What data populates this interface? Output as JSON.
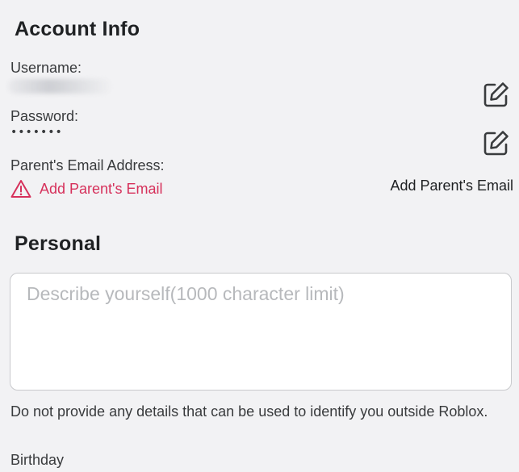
{
  "account_info": {
    "title": "Account Info",
    "username_label": "Username:",
    "password_label": "Password:",
    "password_value": "•••••••",
    "parent_email_label": "Parent's Email Address:",
    "add_parent_email_link": "Add Parent's Email",
    "add_parent_email_button": "Add Parent's Email"
  },
  "personal": {
    "title": "Personal",
    "description_placeholder": "Describe yourself(1000 character limit)",
    "description_value": "",
    "privacy_note": "Do not provide any details that can be used to identify you outside Roblox.",
    "birthday_label": "Birthday"
  },
  "icons": {
    "edit_username": "edit-icon",
    "edit_password": "edit-icon",
    "warning": "warning-triangle-icon"
  },
  "colors": {
    "background": "#f2f2f4",
    "warning_red": "#d6315b",
    "text_primary": "#1f2123",
    "text_secondary": "#393b3d",
    "placeholder": "#b7b9bc"
  }
}
